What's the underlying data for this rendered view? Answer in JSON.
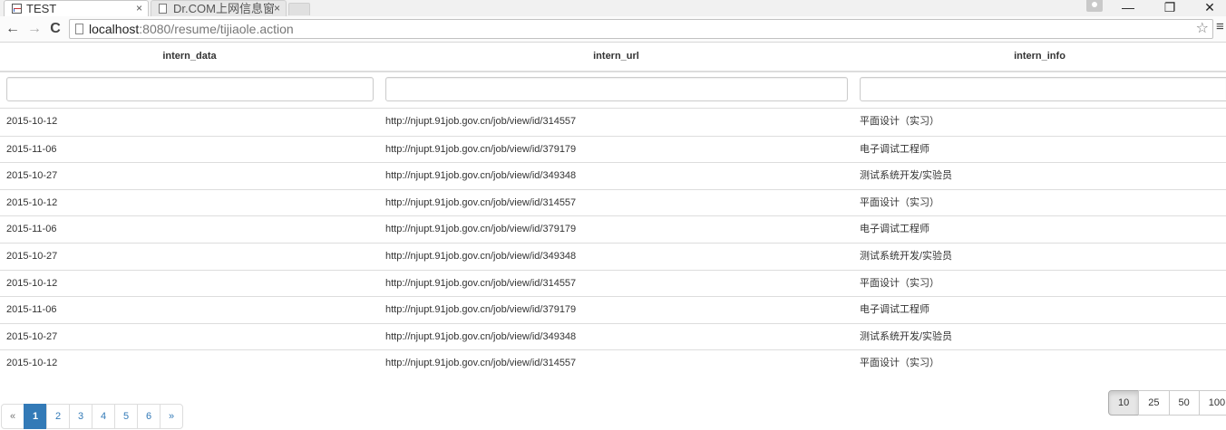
{
  "browser": {
    "tabs": [
      {
        "title": "TEST",
        "close": "×"
      },
      {
        "title": "Dr.COM上网信息窗",
        "close": "×"
      }
    ],
    "url_host": "localhost",
    "url_rest": ":8080/resume/tijiaole.action",
    "back": "←",
    "forward": "→",
    "reload": "C",
    "star": "☆",
    "menu": "≡",
    "minimize": "—",
    "restore": "❐",
    "close": "✕"
  },
  "table": {
    "columns": [
      "intern_data",
      "intern_url",
      "intern_info"
    ],
    "rows": [
      [
        "2015-10-12",
        "http://njupt.91job.gov.cn/job/view/id/314557",
        "平面设计（实习）"
      ],
      [
        "2015-11-06",
        "http://njupt.91job.gov.cn/job/view/id/379179",
        "电子调试工程师"
      ],
      [
        "2015-10-27",
        "http://njupt.91job.gov.cn/job/view/id/349348",
        "测试系统开发/实验员"
      ],
      [
        "2015-10-12",
        "http://njupt.91job.gov.cn/job/view/id/314557",
        "平面设计（实习）"
      ],
      [
        "2015-11-06",
        "http://njupt.91job.gov.cn/job/view/id/379179",
        "电子调试工程师"
      ],
      [
        "2015-10-27",
        "http://njupt.91job.gov.cn/job/view/id/349348",
        "测试系统开发/实验员"
      ],
      [
        "2015-10-12",
        "http://njupt.91job.gov.cn/job/view/id/314557",
        "平面设计（实习）"
      ],
      [
        "2015-11-06",
        "http://njupt.91job.gov.cn/job/view/id/379179",
        "电子调试工程师"
      ],
      [
        "2015-10-27",
        "http://njupt.91job.gov.cn/job/view/id/349348",
        "测试系统开发/实验员"
      ],
      [
        "2015-10-12",
        "http://njupt.91job.gov.cn/job/view/id/314557",
        "平面设计（实习）"
      ]
    ]
  },
  "pagination": {
    "prev": "«",
    "pages": [
      "1",
      "2",
      "3",
      "4",
      "5",
      "6"
    ],
    "next": "»",
    "active_page": "1"
  },
  "page_size": {
    "options": [
      "10",
      "25",
      "50",
      "100"
    ],
    "selected": "10"
  },
  "colors": {
    "accent": "#337ab7",
    "border": "#dddddd"
  }
}
